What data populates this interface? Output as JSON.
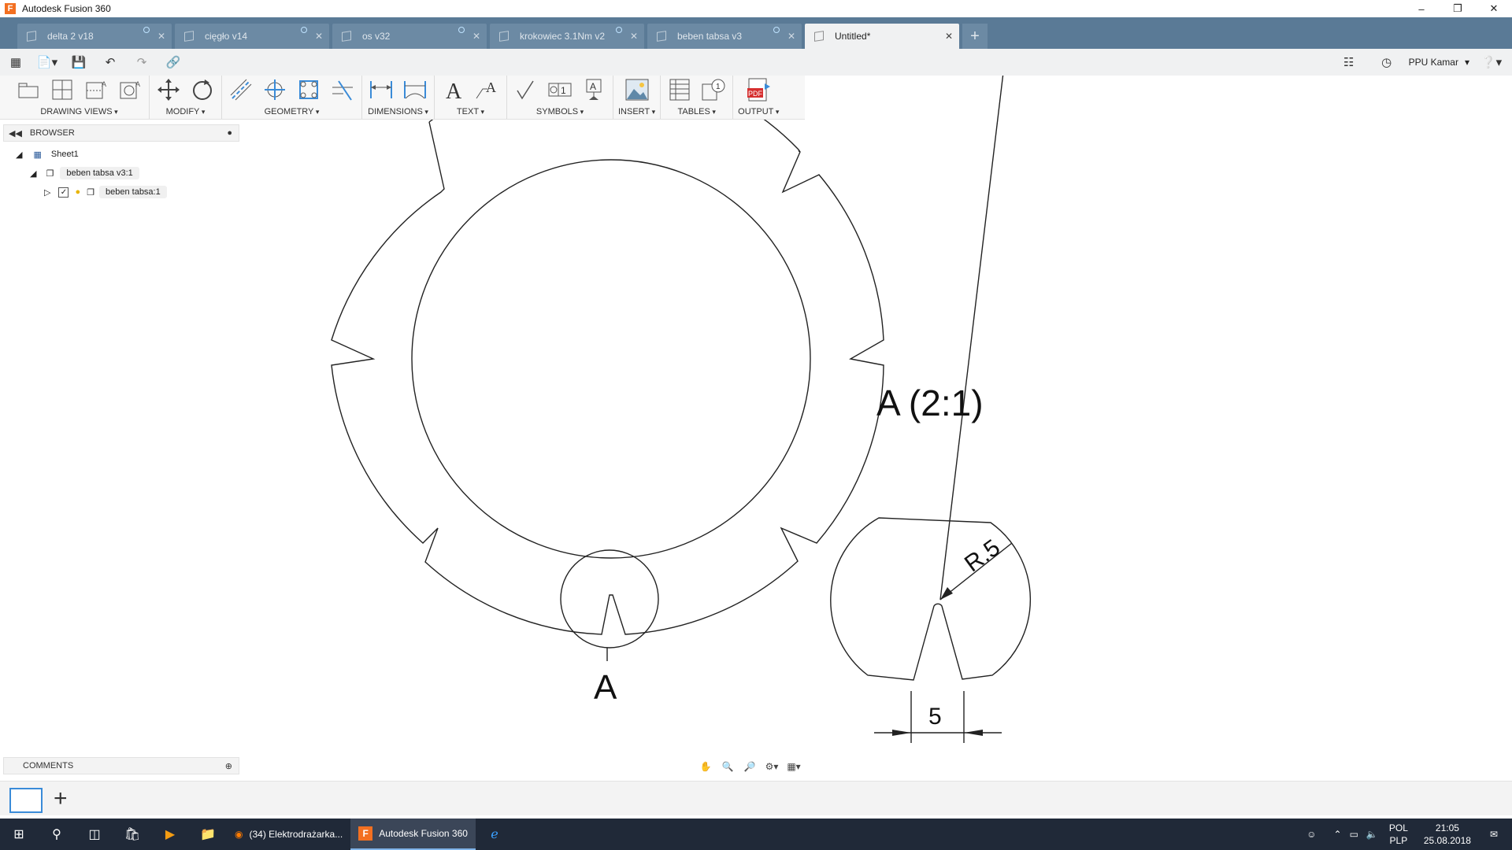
{
  "window": {
    "title": "Autodesk Fusion 360"
  },
  "tabs": [
    {
      "label": "delta 2 v18"
    },
    {
      "label": "cięgło v14"
    },
    {
      "label": "os v32"
    },
    {
      "label": "krokowiec 3.1Nm v2"
    },
    {
      "label": "beben tabsa v3"
    },
    {
      "label": "Untitled*"
    }
  ],
  "user": {
    "name": "PPU Kamar"
  },
  "ribbon": {
    "groups": [
      "DRAWING VIEWS",
      "MODIFY",
      "GEOMETRY",
      "DIMENSIONS",
      "TEXT",
      "SYMBOLS",
      "INSERT",
      "TABLES",
      "OUTPUT"
    ]
  },
  "browser": {
    "title": "BROWSER",
    "items": [
      {
        "label": "Sheet1"
      },
      {
        "label": "beben tabsa v3:1"
      },
      {
        "label": "beben tabsa:1"
      }
    ]
  },
  "comments": {
    "title": "COMMENTS"
  },
  "drawing": {
    "detail_label": "A",
    "detail_title": "A (2:1)",
    "radius_label": "R.5",
    "dimension_label": "5"
  },
  "taskbar": {
    "apps": [
      {
        "label": "(34) Elektrodrażarka..."
      },
      {
        "label": "Autodesk Fusion 360"
      }
    ],
    "lang_top": "POL",
    "lang_bottom": "PLP",
    "time": "21:05",
    "date": "25.08.2018"
  },
  "colors": {
    "tabbar": "#5a7a96",
    "accent": "#3a8bd8",
    "taskbar": "#202938",
    "autodesk_orange": "#f37021"
  }
}
